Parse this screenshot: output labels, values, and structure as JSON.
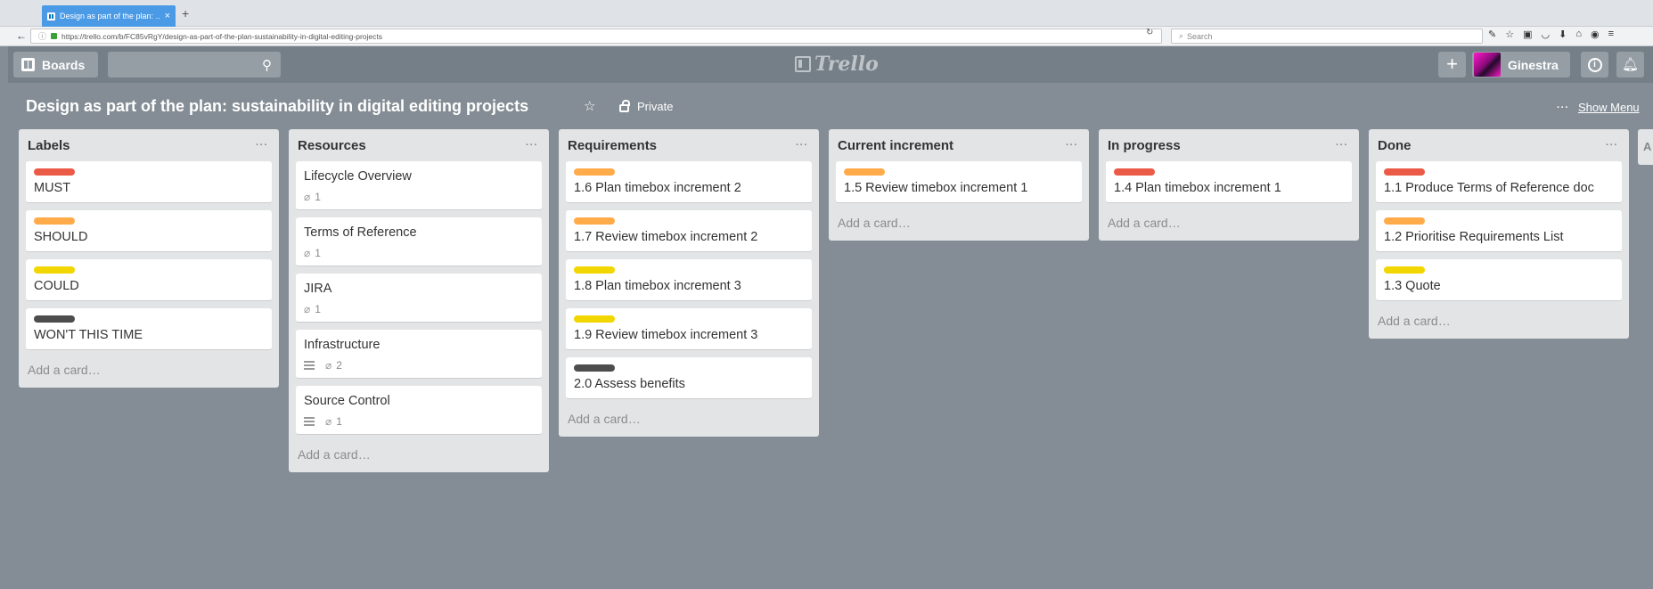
{
  "browser": {
    "tab_title": "Design as part of the plan: ...",
    "tab_close": "×",
    "new_tab": "+",
    "url": "https://trello.com/b/FC85vRgY/design-as-part-of-the-plan-sustainability-in-digital-editing-projects",
    "search_placeholder": "Search"
  },
  "header": {
    "boards_label": "Boards",
    "logo_text": "Trello",
    "add_label": "+",
    "member_name": "Ginestra"
  },
  "board": {
    "title": "Design as part of the plan: sustainability in digital editing projects",
    "visibility": "Private",
    "show_menu_label": "Show Menu",
    "more_dots": "···"
  },
  "colors": {
    "red": "#eb5a46",
    "orange": "#ffab4a",
    "yellow": "#f2d600",
    "black": "#4d4d4d",
    "background": "#848d95"
  },
  "lists": [
    {
      "title": "Labels",
      "menu": "···",
      "add_card": "Add a card…",
      "cards": [
        {
          "label_color": "red",
          "title": "MUST"
        },
        {
          "label_color": "orange",
          "title": "SHOULD"
        },
        {
          "label_color": "yellow",
          "title": "COULD"
        },
        {
          "label_color": "black",
          "title": "WON'T THIS TIME"
        }
      ]
    },
    {
      "title": "Resources",
      "menu": "···",
      "add_card": "Add a card…",
      "cards": [
        {
          "title": "Lifecycle Overview",
          "attachments": "1"
        },
        {
          "title": "Terms of Reference",
          "attachments": "1"
        },
        {
          "title": "JIRA",
          "attachments": "1"
        },
        {
          "title": "Infrastructure",
          "has_description": true,
          "attachments": "2"
        },
        {
          "title": "Source Control",
          "has_description": true,
          "attachments": "1"
        }
      ]
    },
    {
      "title": "Requirements",
      "menu": "···",
      "add_card": "Add a card…",
      "cards": [
        {
          "label_color": "orange",
          "title": "1.6 Plan timebox increment 2"
        },
        {
          "label_color": "orange",
          "title": "1.7 Review timebox increment 2"
        },
        {
          "label_color": "yellow",
          "title": "1.8 Plan timebox increment 3"
        },
        {
          "label_color": "yellow",
          "title": "1.9 Review timebox increment 3"
        },
        {
          "label_color": "black",
          "title": "2.0 Assess benefits"
        }
      ]
    },
    {
      "title": "Current increment",
      "menu": "···",
      "add_card": "Add a card…",
      "cards": [
        {
          "label_color": "orange",
          "title": "1.5 Review timebox increment 1"
        }
      ]
    },
    {
      "title": "In progress",
      "menu": "···",
      "add_card": "Add a card…",
      "cards": [
        {
          "label_color": "red",
          "title": "1.4 Plan timebox increment 1"
        }
      ]
    },
    {
      "title": "Done",
      "menu": "···",
      "add_card": "Add a card…",
      "cards": [
        {
          "label_color": "red",
          "title": "1.1 Produce Terms of Reference doc"
        },
        {
          "label_color": "orange",
          "title": "1.2 Prioritise Requirements List"
        },
        {
          "label_color": "yellow",
          "title": "1.3 Quote"
        }
      ]
    }
  ],
  "side_peek_letter": "A"
}
